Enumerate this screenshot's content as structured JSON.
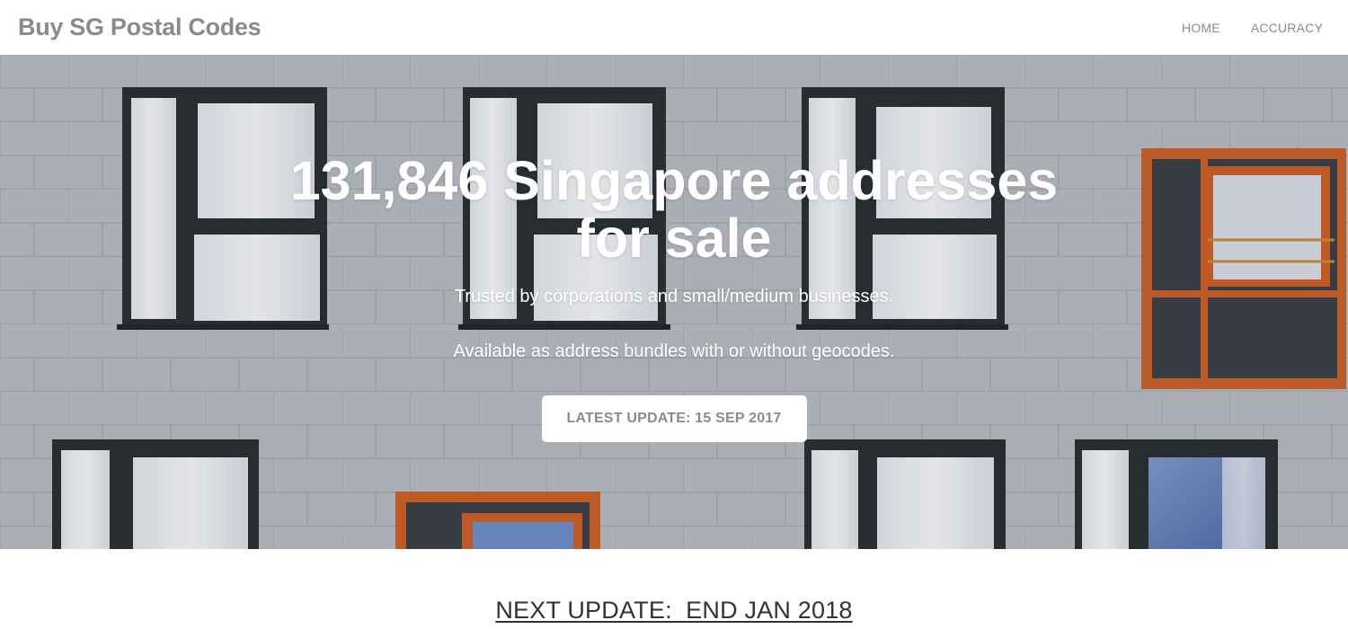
{
  "navbar": {
    "brand": "Buy SG Postal Codes",
    "links": [
      "HOME",
      "ACCURACY"
    ]
  },
  "hero": {
    "title": "131,846 Singapore addresses for sale",
    "line_one": "Trusted by corporations and small/medium businesses.",
    "line_two": "Available as address bundles with or without geocodes.",
    "cta_label": "LATEST UPDATE: 15 SEP 2017",
    "background": "building facade with windows"
  },
  "next_update": {
    "text": "NEXT UPDATE:  END JAN 2018"
  },
  "colors": {
    "nav_text": "#8a8a8a",
    "hero_wall": "#b9bcc3",
    "window_frame": "#2b3035",
    "orange_frame": "#c8612a",
    "curtain": "#e8ebf1"
  }
}
